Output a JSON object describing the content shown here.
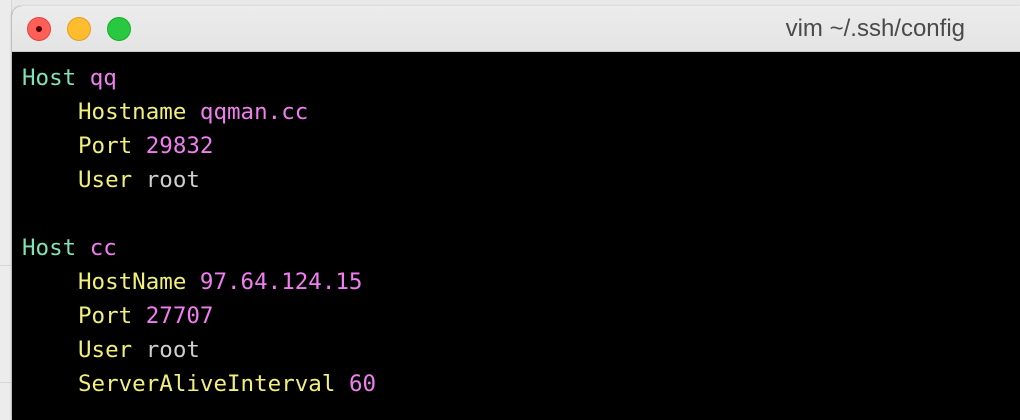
{
  "window": {
    "title": "vim ~/.ssh/config"
  },
  "colors": {
    "host_keyword": "#7fe3b5",
    "option_keyword": "#f2f07a",
    "value_magenta": "#f07ef0",
    "value_plain": "#cfcfcf",
    "background": "#000000"
  },
  "config": {
    "block1": {
      "host_kw": "Host",
      "host_name": "qq",
      "opt1_key": "Hostname",
      "opt1_val": "qqman.cc",
      "opt2_key": "Port",
      "opt2_val": "29832",
      "opt3_key": "User",
      "opt3_val": "root"
    },
    "block2": {
      "host_kw": "Host",
      "host_name": "cc",
      "opt1_key": "HostName",
      "opt1_val": "97.64.124.15",
      "opt2_key": "Port",
      "opt2_val": "27707",
      "opt3_key": "User",
      "opt3_val": "root",
      "opt4_key": "ServerAliveInterval",
      "opt4_val": "60"
    }
  }
}
